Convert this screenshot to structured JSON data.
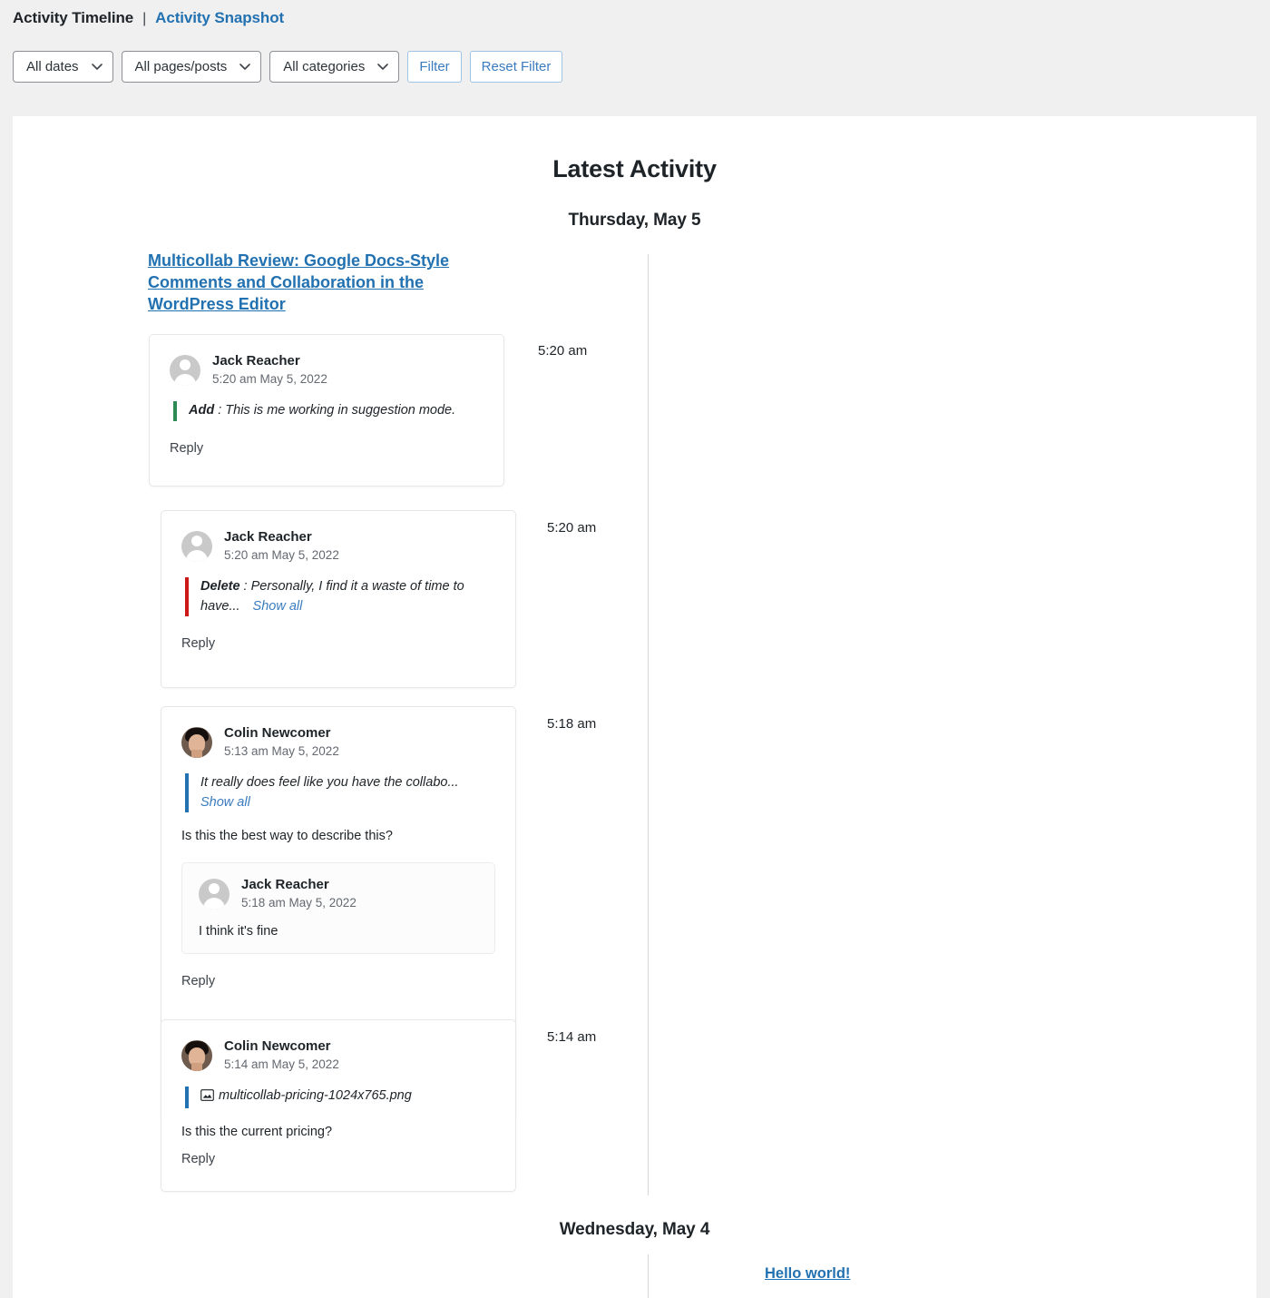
{
  "header": {
    "title": "Activity Timeline",
    "separator": "|",
    "snapshot_link": "Activity Snapshot"
  },
  "filters": {
    "dates": "All dates",
    "pages": "All pages/posts",
    "categories": "All categories",
    "filter_button": "Filter",
    "reset_button": "Reset Filter"
  },
  "main": {
    "title": "Latest Activity",
    "days": [
      {
        "label": "Thursday, May 5"
      },
      {
        "label": "Wednesday, May 4"
      }
    ],
    "post_link": "Multicollab Review: Google Docs-Style Comments and Collaboration in the WordPress Editor",
    "hello_link": "Hello world!"
  },
  "entries": [
    {
      "time_marker": "5:20 am",
      "author": "Jack Reacher",
      "timestamp": "5:20 am May 5, 2022",
      "avatar": "generic-avatar",
      "quote_label": "Add",
      "quote_sep": " : ",
      "quote_text": "This is me working in suggestion mode.",
      "quote_color": "#2d8a54",
      "reply": "Reply"
    },
    {
      "time_marker": "5:20 am",
      "author": "Jack Reacher",
      "timestamp": "5:20 am May 5, 2022",
      "avatar": "generic-avatar",
      "quote_label": "Delete",
      "quote_sep": " : ",
      "quote_text": "Personally, I find it a waste of time to have...",
      "quote_color": "#cc1818",
      "show_all": "Show all",
      "reply": "Reply"
    },
    {
      "time_marker": "5:18 am",
      "author": "Colin Newcomer",
      "timestamp": "5:13 am May 5, 2022",
      "avatar": "photo-avatar",
      "quote_text": "It really does feel like you have the collabo...",
      "quote_color": "#2271b1",
      "show_all": "Show all",
      "body": "Is this the best way to describe this?",
      "reply": "Reply",
      "sub": {
        "author": "Jack Reacher",
        "timestamp": "5:18 am May 5, 2022",
        "avatar": "generic-avatar",
        "body": "I think it's fine"
      }
    },
    {
      "time_marker": "5:14 am",
      "author": "Colin Newcomer",
      "timestamp": "5:14 am May 5, 2022",
      "avatar": "photo-avatar",
      "attachment_icon": "image-icon",
      "quote_text": "multicollab-pricing-1024x765.png",
      "quote_color": "#2271b1",
      "body": "Is this the current pricing?",
      "reply": "Reply"
    }
  ],
  "colors": {
    "accent": "#2271b1",
    "page_bg": "#f0f0f1",
    "panel_bg": "#ffffff",
    "axis": "#d6d6d8"
  }
}
